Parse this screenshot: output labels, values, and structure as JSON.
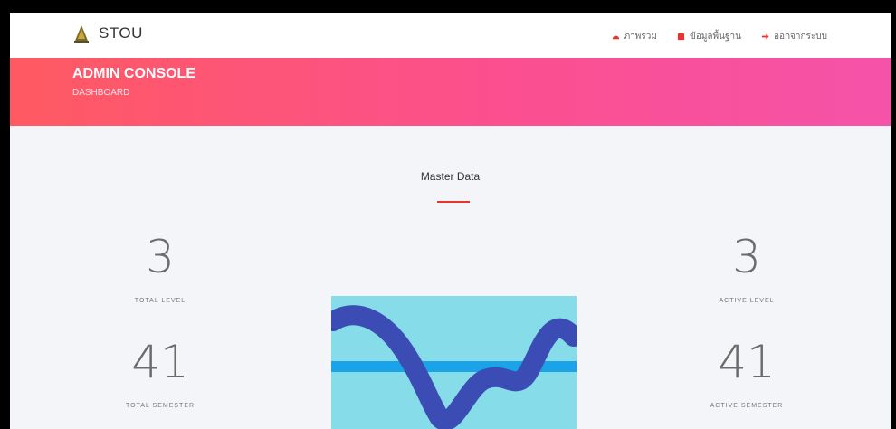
{
  "navbar": {
    "brand": "STOU",
    "items": [
      {
        "label": "ภาพรวม",
        "icon": "dashboard-icon"
      },
      {
        "label": "ข้อมูลพื้นฐาน",
        "icon": "database-icon"
      },
      {
        "label": "ออกจากระบบ",
        "icon": "logout-icon"
      }
    ]
  },
  "hero": {
    "title": "ADMIN CONSOLE",
    "subtitle": "DASHBOARD"
  },
  "master": {
    "title": "Master Data"
  },
  "stats": {
    "total_level": {
      "value": "3",
      "label": "TOTAL LEVEL"
    },
    "active_level": {
      "value": "3",
      "label": "ACTIVE LEVEL"
    },
    "total_semester": {
      "value": "41",
      "label": "TOTAL SEMESTER"
    },
    "active_semester": {
      "value": "41",
      "label": "ACTIVE SEMESTER"
    }
  },
  "colors": {
    "accent_red": "#e8342c",
    "hero_start": "#ff5a62",
    "hero_end": "#f552a9",
    "chart_bg": "#86dce8",
    "chart_line": "#3b4db5"
  }
}
